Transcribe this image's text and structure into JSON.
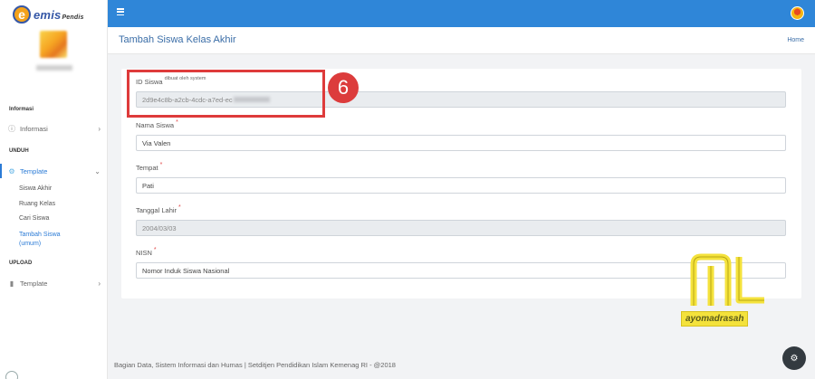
{
  "brand": {
    "logo_letter": "e",
    "logo_main": "emis",
    "logo_sub": "Pendis"
  },
  "sidebar": {
    "sections": [
      {
        "title": "Informasi"
      },
      {
        "title": "UNDUH"
      },
      {
        "title": "UPLOAD"
      }
    ],
    "items": [
      {
        "label": "Informasi",
        "icon": "info-circle-icon"
      },
      {
        "label": "Template",
        "icon": "gear-icon"
      },
      {
        "label": "Template",
        "icon": "file-icon"
      }
    ],
    "sub_items": [
      {
        "label": "Siswa Akhir"
      },
      {
        "label": "Ruang Kelas"
      },
      {
        "label": "Cari Siswa"
      },
      {
        "label": "Tambah Siswa (umum)"
      }
    ]
  },
  "header": {
    "title": "Tambah Siswa Kelas Akhir",
    "breadcrumb": "Home"
  },
  "form": {
    "id_siswa": {
      "label": "ID Siswa",
      "hint": "dibuat oleh system",
      "value": "2d9e4c8b-a2cb-4cdc-a7ed-ec"
    },
    "nama_siswa": {
      "label": "Nama Siswa",
      "required": "*",
      "value": "Via Valen"
    },
    "tempat": {
      "label": "Tempat",
      "required": "*",
      "value": "Pati"
    },
    "tanggal_lahir": {
      "label": "Tanggal Lahir",
      "required": "*",
      "value": "2004/03/03"
    },
    "nisn": {
      "label": "NISN",
      "required": "*",
      "placeholder": "Nomor Induk Siswa Nasional"
    }
  },
  "annotation": {
    "step": "6"
  },
  "watermark": {
    "text": "ayomadrasah"
  },
  "footer": {
    "text": "Bagian Data, Sistem Informasi dan Humas | Setditjen Pendidikan Islam Kemenag RI - @2018"
  },
  "colors": {
    "primary": "#2f86d8",
    "highlight": "#de3b3b",
    "watermark": "#f4e23c"
  }
}
